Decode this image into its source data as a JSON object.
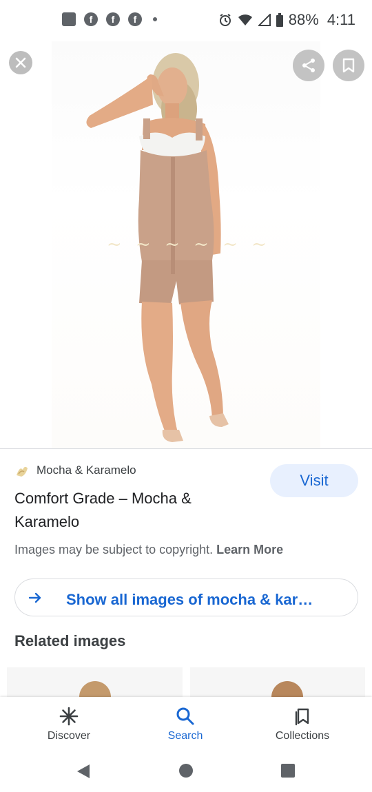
{
  "status_bar": {
    "battery_percent": "88%",
    "time": "4:11"
  },
  "result": {
    "source_name": "Mocha & Karamelo",
    "title": "Comfort Grade – Mocha & Karamelo",
    "visit_label": "Visit",
    "copyright_text": "Images may be subject to copyright.",
    "learn_more_label": "Learn More",
    "show_all_label": "Show all images of mocha & kar…"
  },
  "related": {
    "heading": "Related images"
  },
  "bottom_nav": {
    "items": [
      {
        "label": "Discover",
        "icon": "asterisk-icon",
        "active": false
      },
      {
        "label": "Search",
        "icon": "search-icon",
        "active": true
      },
      {
        "label": "Collections",
        "icon": "collections-icon",
        "active": false
      }
    ]
  },
  "colors": {
    "accent": "#1967d2",
    "visit_bg": "#e8f0fe",
    "overlay_button": "#bdbdbd",
    "text_primary": "#202124",
    "text_secondary": "#5f6368"
  }
}
